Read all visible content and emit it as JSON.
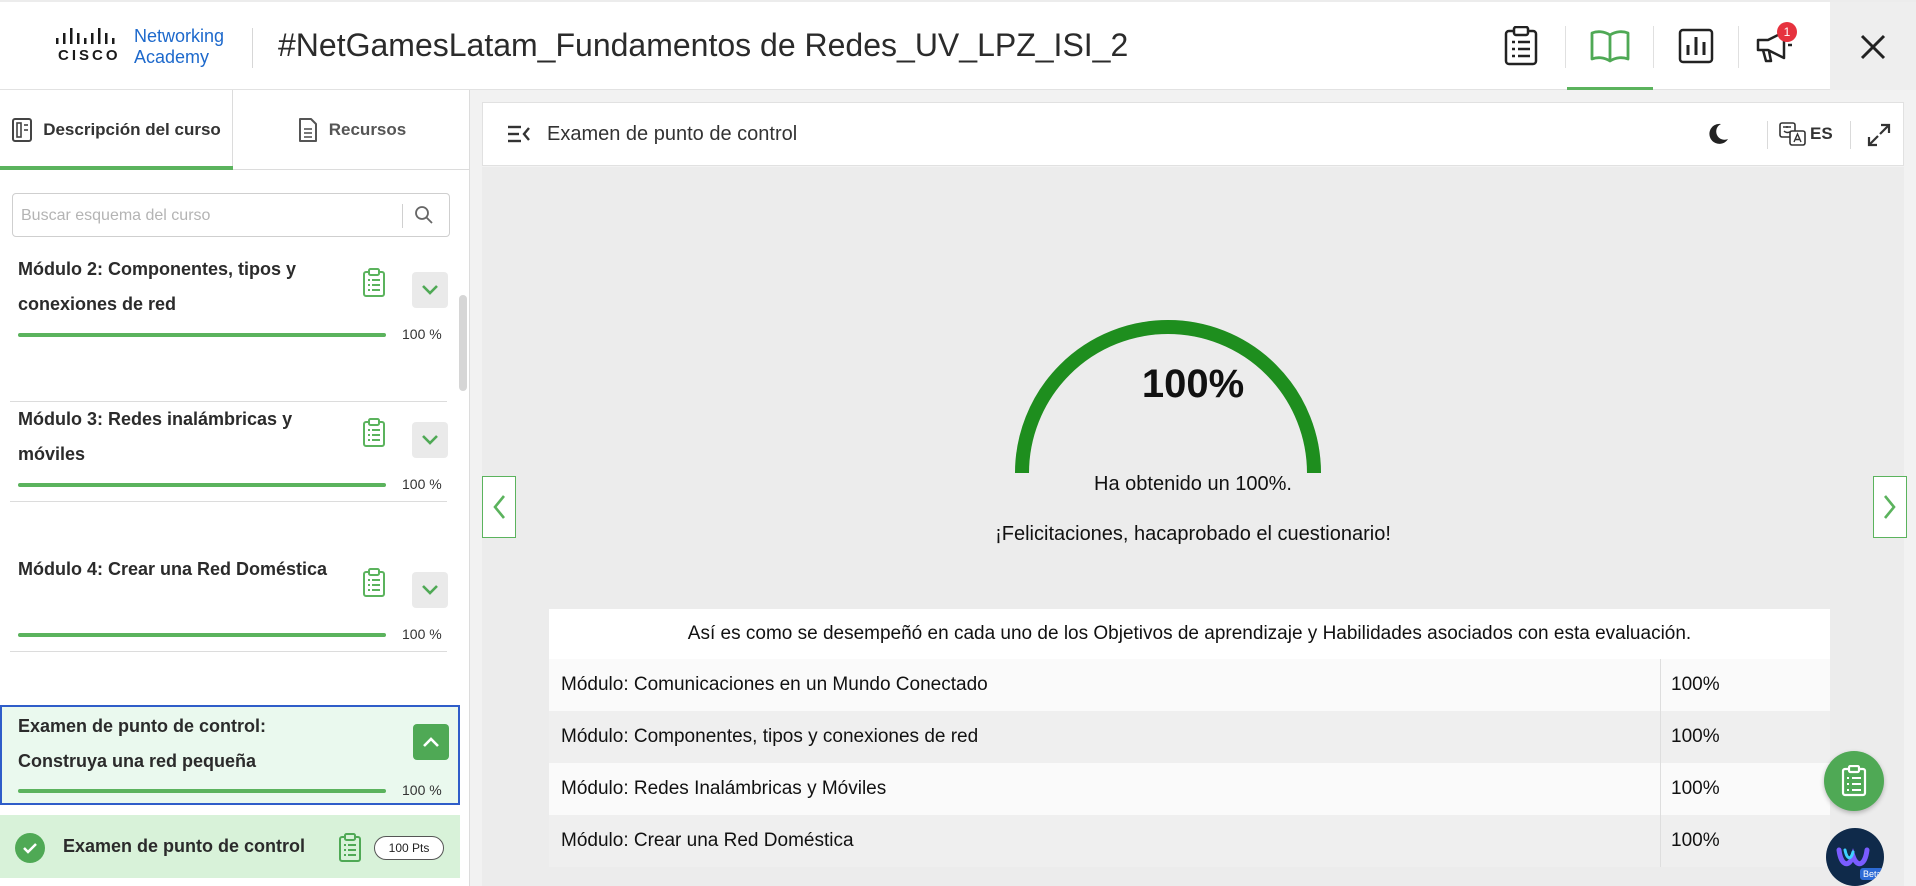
{
  "header": {
    "brand_cisco": "CISCO",
    "brand_line1": "Networking",
    "brand_line2": "Academy",
    "course_title": "#NetGamesLatam_Fundamentos de Redes_UV_LPZ_ISI_2",
    "notification_count": "1",
    "icons": [
      "clipboard-icon",
      "book-icon",
      "chart-icon",
      "megaphone-icon",
      "close-icon"
    ]
  },
  "sidebar": {
    "tabs": [
      {
        "label": "Descripción del curso",
        "active": true
      },
      {
        "label": "Recursos",
        "active": false
      }
    ],
    "search": {
      "placeholder": "Buscar esquema del curso",
      "value": ""
    },
    "modules": [
      {
        "title": "Módulo 2: Componentes, tipos y conexiones de red",
        "progress": "100 %",
        "progress_value": 1.0
      },
      {
        "title": "Módulo 3: Redes inalámbricas y móviles",
        "progress": "100 %",
        "progress_value": 1.0
      },
      {
        "title": "Módulo 4: Crear una Red Doméstica",
        "progress": "100 %",
        "progress_value": 1.0
      },
      {
        "title": "Examen de punto de control: Construya una red pequeña",
        "progress": "100 %",
        "progress_value": 1.0,
        "active": true
      }
    ],
    "subitem": {
      "title": "Examen de punto de control",
      "points": "100 Pts",
      "completed": true
    }
  },
  "panel": {
    "title": "Examen de punto de control",
    "language": "ES"
  },
  "result": {
    "score_label": "100%",
    "score_value": 1.0,
    "message1": "Ha obtenido un 100%.",
    "message2": "¡Felicitaciones, hacaprobado el cuestionario!",
    "table_caption": "Así es como se desempeñó en cada uno de los Objetivos de aprendizaje y Habilidades asociados con esta evaluación.",
    "rows": [
      {
        "module": "Módulo: Comunicaciones en un Mundo Conectado",
        "score": "100%"
      },
      {
        "module": "Módulo: Componentes, tipos y conexiones de red",
        "score": "100%"
      },
      {
        "module": "Módulo: Redes Inalámbricas y Móviles",
        "score": "100%"
      },
      {
        "module": "Módulo: Crear una Red Doméstica",
        "score": "100%"
      }
    ]
  },
  "colors": {
    "accent_green": "#5bb35d",
    "gauge_green": "#1e8e1e",
    "active_border": "#2f5dc9",
    "badge_red": "#e6323e"
  }
}
